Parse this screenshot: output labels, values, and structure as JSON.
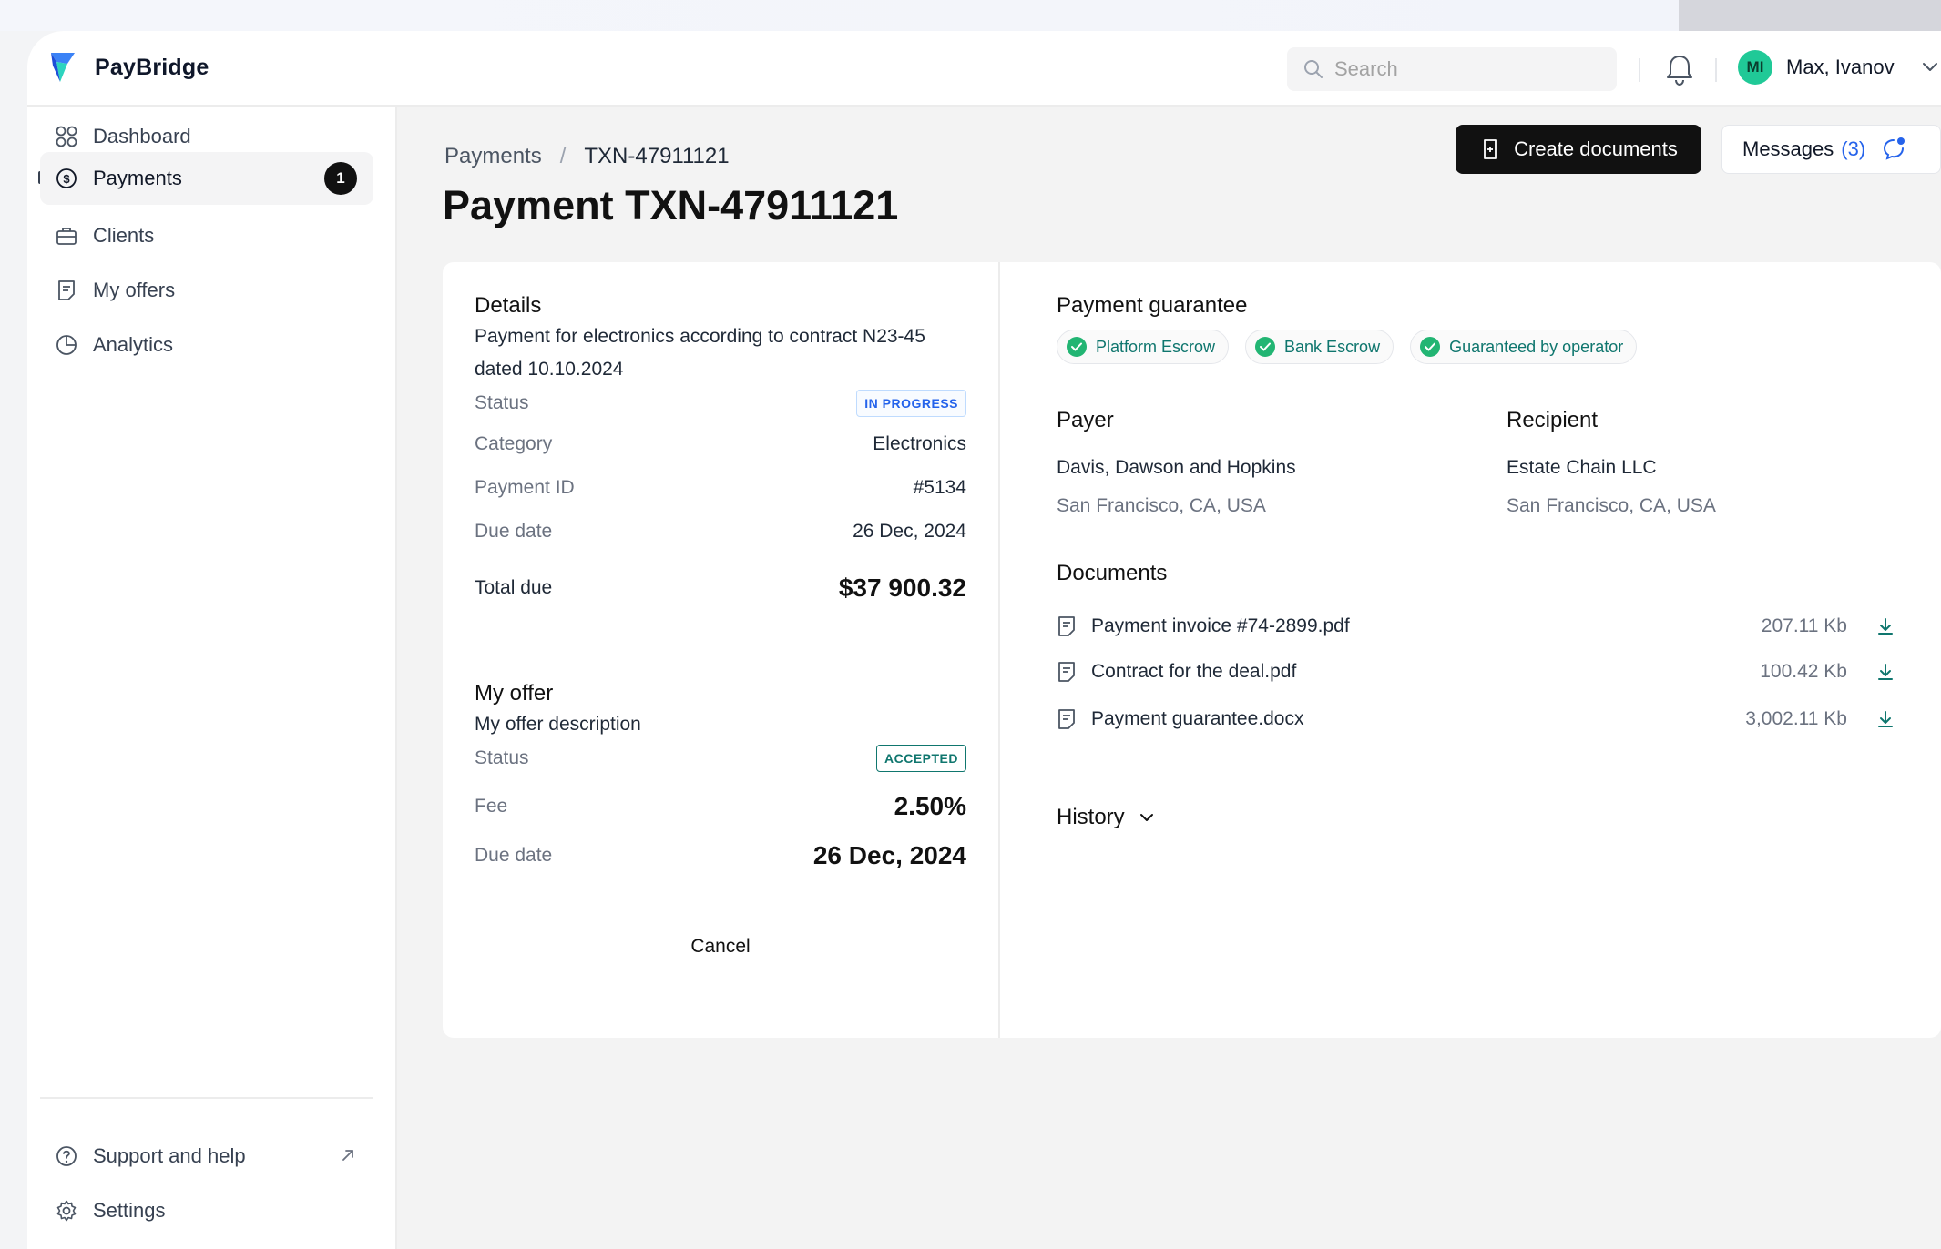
{
  "app": {
    "name": "PayBridge"
  },
  "topbar": {
    "search_placeholder": "Search",
    "user": {
      "initials": "MI",
      "name": "Max, Ivanov"
    }
  },
  "sidebar": {
    "items": [
      {
        "label": "Dashboard"
      },
      {
        "label": "Payments",
        "badge": "1",
        "active": true
      },
      {
        "label": "Clients"
      },
      {
        "label": "My offers"
      },
      {
        "label": "Analytics"
      }
    ],
    "footer": [
      {
        "label": "Support and help"
      },
      {
        "label": "Settings"
      }
    ]
  },
  "breadcrumb": {
    "parent": "Payments",
    "separator": "/",
    "current": "TXN-47911121"
  },
  "page": {
    "title": "Payment TXN-47911121"
  },
  "actions": {
    "create_documents": "Create documents",
    "messages_label": "Messages",
    "messages_count": "(3)"
  },
  "details": {
    "title": "Details",
    "description": "Payment for electronics according to contract N23-45 dated 10.10.2024",
    "rows": [
      {
        "key": "Status",
        "value": "IN PROGRESS"
      },
      {
        "key": "Category",
        "value": "Electronics"
      },
      {
        "key": "Payment ID",
        "value": "#5134"
      },
      {
        "key": "Due date",
        "value": "26 Dec, 2024"
      }
    ],
    "total_label": "Total due",
    "total_value": "$37 900.32"
  },
  "offer": {
    "title": "My offer",
    "description": "My offer description",
    "status_label": "Status",
    "status_value": "ACCEPTED",
    "fee_label": "Fee",
    "fee_value": "2.50%",
    "due_label": "Due date",
    "due_value": "26 Dec, 2024",
    "cancel": "Cancel"
  },
  "guarantee": {
    "title": "Payment guarantee",
    "chips": [
      "Platform Escrow",
      "Bank Escrow",
      "Guaranteed by operator"
    ]
  },
  "payer": {
    "title": "Payer",
    "name": "Davis, Dawson and Hopkins",
    "location": "San Francisco, CA, USA"
  },
  "recipient": {
    "title": "Recipient",
    "name": "Estate Chain LLC",
    "location": "San Francisco, CA, USA"
  },
  "documents": {
    "title": "Documents",
    "items": [
      {
        "name": "Payment invoice #74-2899.pdf",
        "size": "207.11 Kb"
      },
      {
        "name": "Contract for the deal.pdf",
        "size": "100.42 Kb"
      },
      {
        "name": "Payment guarantee.docx",
        "size": "3,002.11 Kb"
      }
    ]
  },
  "history": {
    "title": "History"
  },
  "colors": {
    "accent": "#111111",
    "link": "#2563eb",
    "success": "#22b573",
    "teal": "#0f766e"
  },
  "icons": {
    "sidebar": [
      "dashboard-icon",
      "payments-icon",
      "clients-icon",
      "offers-icon",
      "analytics-icon"
    ],
    "footer": [
      "help-icon",
      "gear-icon"
    ],
    "documents": "document-icon",
    "download": "download-icon"
  }
}
